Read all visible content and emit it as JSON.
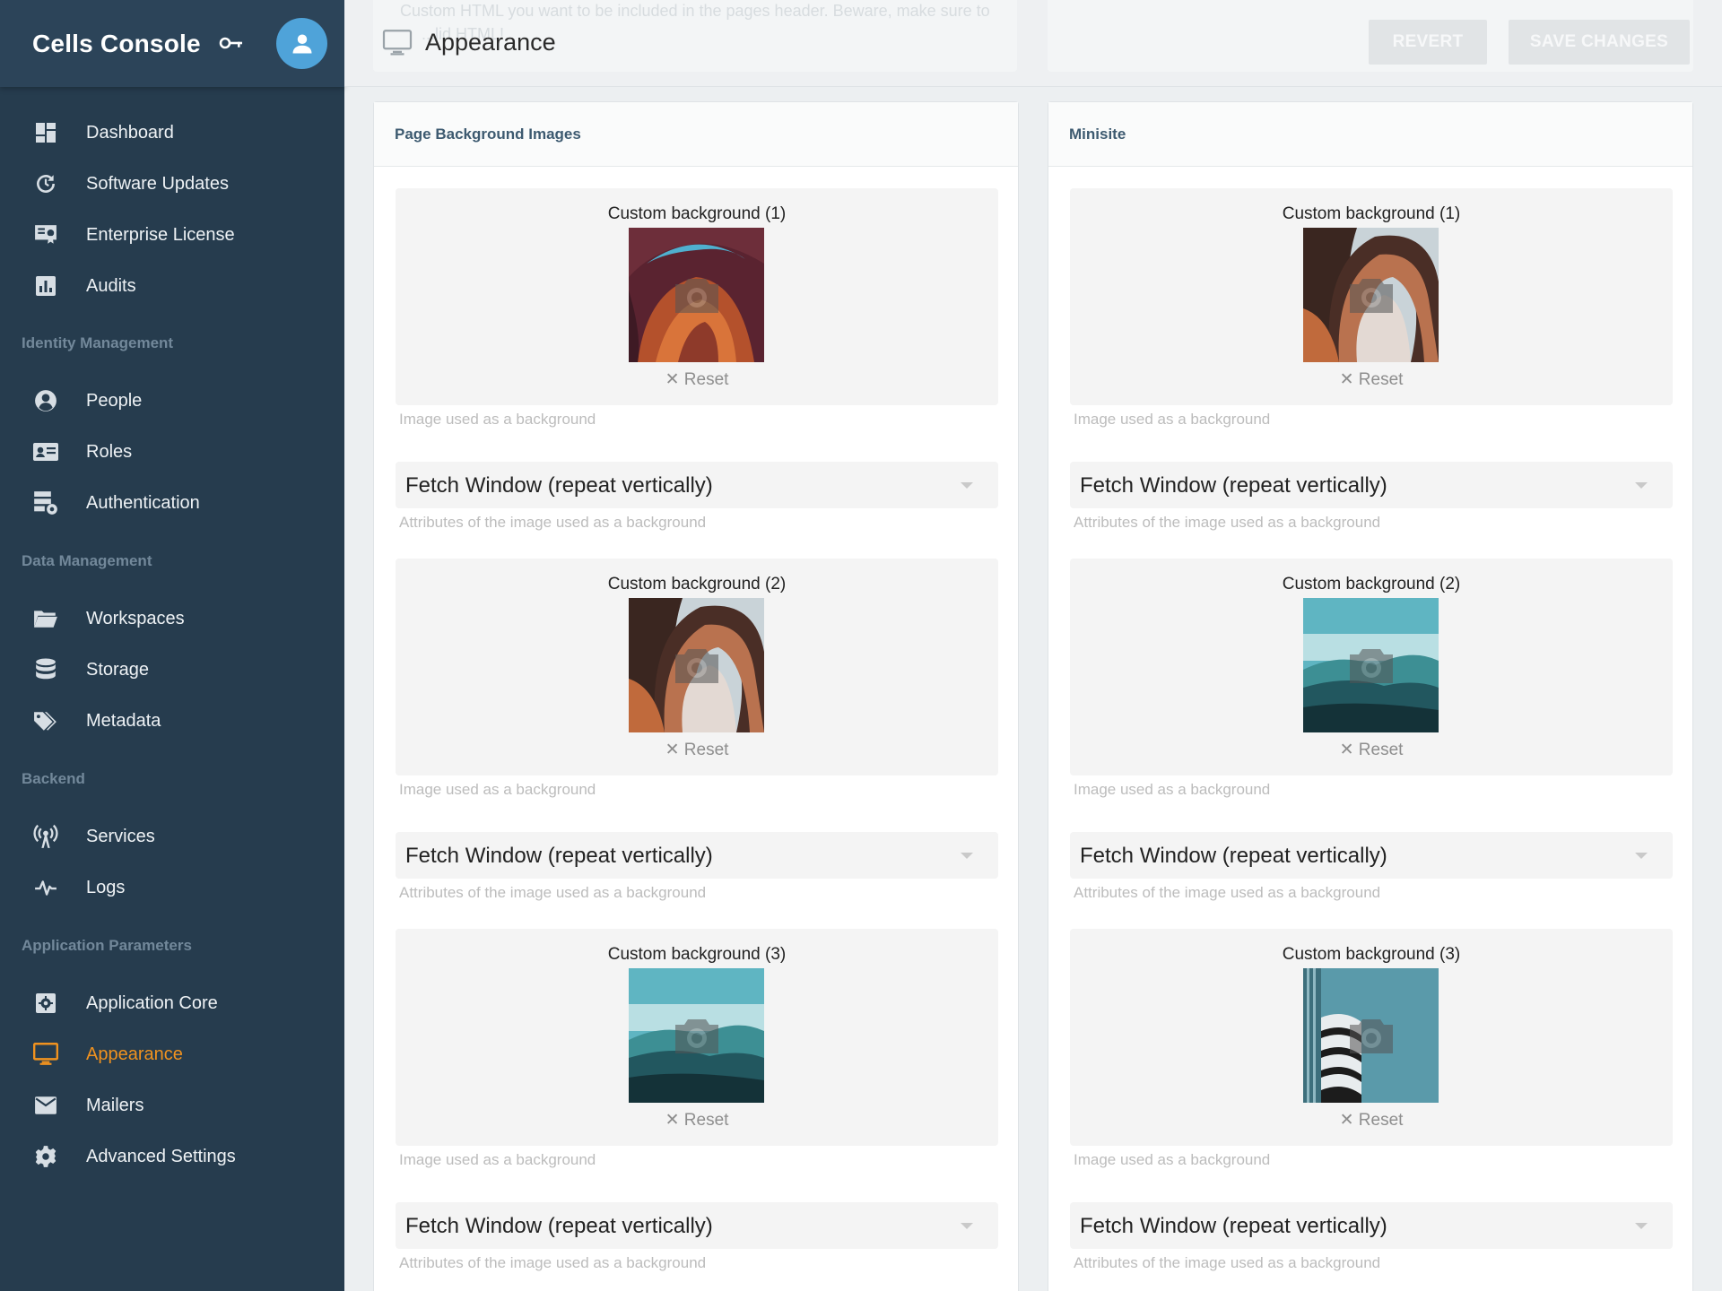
{
  "app": {
    "title": "Cells Console"
  },
  "sidebar": {
    "items": [
      {
        "label": "Dashboard",
        "icon": "dashboard-icon"
      },
      {
        "label": "Software Updates",
        "icon": "update-icon"
      },
      {
        "label": "Enterprise License",
        "icon": "license-icon"
      },
      {
        "label": "Audits",
        "icon": "chart-icon"
      },
      {
        "label": "People",
        "icon": "person-icon"
      },
      {
        "label": "Roles",
        "icon": "id-card-icon"
      },
      {
        "label": "Authentication",
        "icon": "security-icon"
      },
      {
        "label": "Workspaces",
        "icon": "folder-icon"
      },
      {
        "label": "Storage",
        "icon": "database-icon"
      },
      {
        "label": "Metadata",
        "icon": "tags-icon"
      },
      {
        "label": "Services",
        "icon": "antenna-icon"
      },
      {
        "label": "Logs",
        "icon": "pulse-icon"
      },
      {
        "label": "Application Core",
        "icon": "gear-box-icon"
      },
      {
        "label": "Appearance",
        "icon": "monitor-icon",
        "active": true
      },
      {
        "label": "Mailers",
        "icon": "mail-icon"
      },
      {
        "label": "Advanced Settings",
        "icon": "gear-icon"
      }
    ],
    "sections": [
      "Identity Management",
      "Data Management",
      "Backend",
      "Application Parameters"
    ]
  },
  "topbar": {
    "page_title": "Appearance",
    "ghost_text": "Custom HTML you want to be included in the pages header. Beware, make sure to",
    "ghost_text_2": "...lid HTML!",
    "revert_label": "REVERT",
    "save_label": "SAVE CHANGES"
  },
  "cards": {
    "left": {
      "title": "Page Background Images",
      "images": [
        {
          "title": "Custom background (1)",
          "reset": "Reset",
          "hint": "Image used as a background",
          "select": "Fetch Window (repeat vertically)",
          "select_hint": "Attributes of the image used as a background"
        },
        {
          "title": "Custom background (2)",
          "reset": "Reset",
          "hint": "Image used as a background",
          "select": "Fetch Window (repeat vertically)",
          "select_hint": "Attributes of the image used as a background"
        },
        {
          "title": "Custom background (3)",
          "reset": "Reset",
          "hint": "Image used as a background",
          "select": "Fetch Window (repeat vertically)",
          "select_hint": "Attributes of the image used as a background"
        }
      ]
    },
    "right": {
      "title": "Minisite",
      "images": [
        {
          "title": "Custom background (1)",
          "reset": "Reset",
          "hint": "Image used as a background",
          "select": "Fetch Window (repeat vertically)",
          "select_hint": "Attributes of the image used as a background"
        },
        {
          "title": "Custom background (2)",
          "reset": "Reset",
          "hint": "Image used as a background",
          "select": "Fetch Window (repeat vertically)",
          "select_hint": "Attributes of the image used as a background"
        },
        {
          "title": "Custom background (3)",
          "reset": "Reset",
          "hint": "Image used as a background",
          "select": "Fetch Window (repeat vertically)",
          "select_hint": "Attributes of the image used as a background"
        }
      ]
    }
  },
  "colors": {
    "sidebar_bg": "#263c4e",
    "accent": "#f0921f",
    "avatar": "#4fa3d9"
  }
}
